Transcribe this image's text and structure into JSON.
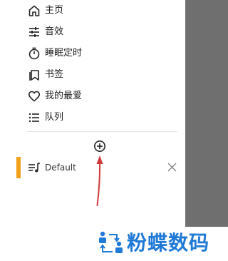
{
  "drawer": {
    "menu": [
      {
        "label": "主页",
        "icon": "home-icon"
      },
      {
        "label": "音效",
        "icon": "equalizer-icon"
      },
      {
        "label": "睡眠定时",
        "icon": "timer-icon"
      },
      {
        "label": "书签",
        "icon": "bookmark-icon"
      },
      {
        "label": "我的最爱",
        "icon": "heart-icon"
      },
      {
        "label": "队列",
        "icon": "queue-icon"
      }
    ],
    "add_playlist_icon": "add-circle-icon",
    "playlist": {
      "label": "Default",
      "icon": "playlist-icon",
      "accent_color": "#f1a01a",
      "remove_icon": "close-icon"
    }
  },
  "annotation": {
    "arrow_color": "#d0393b"
  },
  "watermark": {
    "text": "粉蝶数码",
    "color": "#1f79d6"
  }
}
